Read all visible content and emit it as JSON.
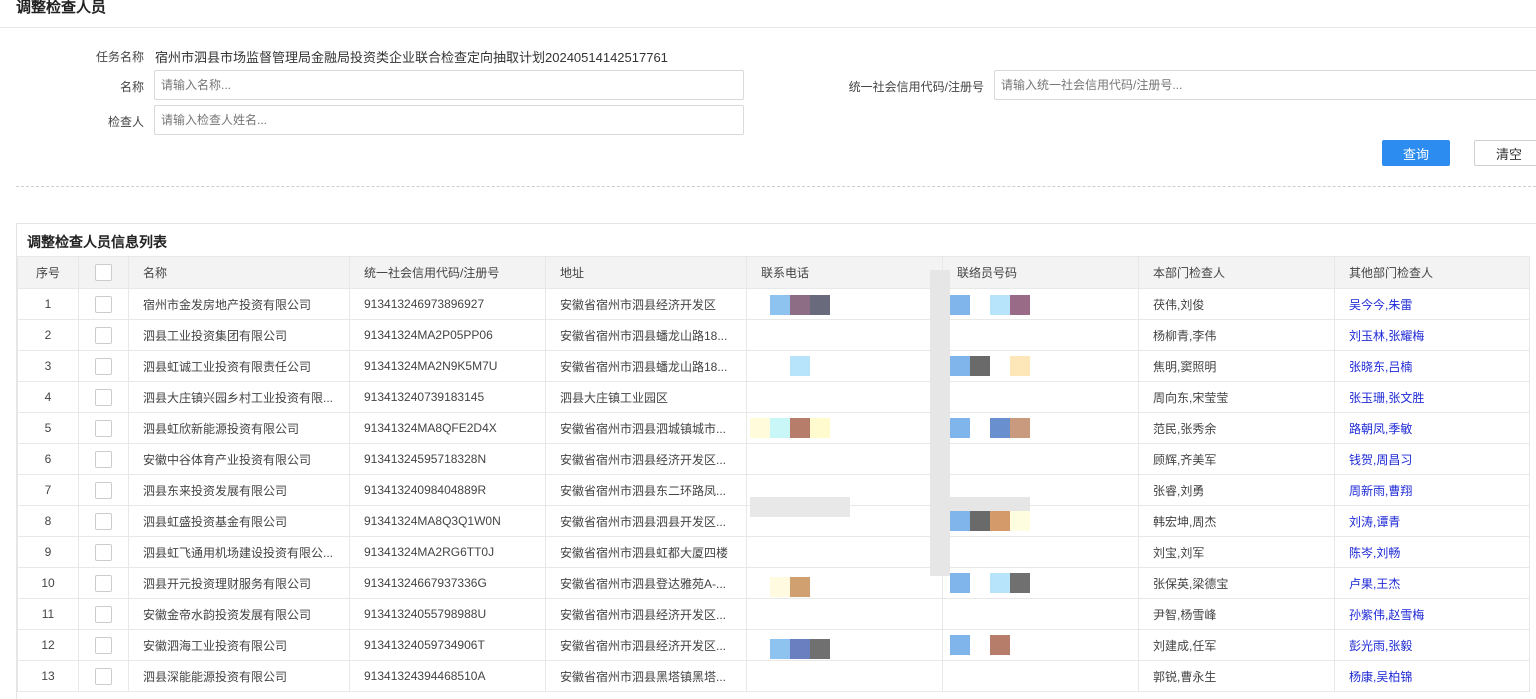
{
  "page": {
    "title": "调整检查人员"
  },
  "task": {
    "label": "任务名称",
    "value": "宿州市泗县市场监督管理局金融局投资类企业联合检查定向抽取计划20240514142517761"
  },
  "form": {
    "name_label": "名称",
    "name_placeholder": "请输入名称...",
    "credit_label": "统一社会信用代码/注册号",
    "credit_placeholder": "请输入统一社会信用代码/注册号...",
    "inspector_label": "检查人",
    "inspector_placeholder": "请输入检查人姓名..."
  },
  "buttons": {
    "query": "查询",
    "clear": "清空"
  },
  "list": {
    "title": "调整检查人员信息列表",
    "columns": [
      "序号",
      "",
      "名称",
      "统一社会信用代码/注册号",
      "地址",
      "联系电话",
      "联络员号码",
      "本部门检查人",
      "其他部门检查人"
    ],
    "rows": [
      {
        "idx": "1",
        "name": "宿州市金发房地产投资有限公司",
        "code": "913413246973896927",
        "addr": "安徽省宿州市泗县经济开发区",
        "phone": "",
        "liaison": "",
        "dept": "茯伟,刘俊",
        "other": "吴今今,朱雷"
      },
      {
        "idx": "2",
        "name": "泗县工业投资集团有限公司",
        "code": "91341324MA2P05PP06",
        "addr": "安徽省宿州市泗县蟠龙山路18...",
        "phone": "",
        "liaison": "",
        "dept": "杨柳青,李伟",
        "other": "刘玉林,张耀梅"
      },
      {
        "idx": "3",
        "name": "泗县虹诚工业投资有限责任公司",
        "code": "91341324MA2N9K5M7U",
        "addr": "安徽省宿州市泗县蟠龙山路18...",
        "phone": "",
        "liaison": "",
        "dept": "焦明,窦照明",
        "other": "张晓东,吕楠"
      },
      {
        "idx": "4",
        "name": "泗县大庄镇兴园乡村工业投资有限...",
        "code": "913413240739183145",
        "addr": "泗县大庄镇工业园区",
        "phone": "",
        "liaison": "",
        "dept": "周向东,宋莹莹",
        "other": "张玉珊,张文胜"
      },
      {
        "idx": "5",
        "name": "泗县虹欣新能源投资有限公司",
        "code": "91341324MA8QFE2D4X",
        "addr": "安徽省宿州市泗县泗城镇城市...",
        "phone": "",
        "liaison": "",
        "dept": "范民,张秀余",
        "other": "路朝凤,季敏"
      },
      {
        "idx": "6",
        "name": "安徽中谷体育产业投资有限公司",
        "code": "91341324595718328N",
        "addr": "安徽省宿州市泗县经济开发区...",
        "phone": "",
        "liaison": "",
        "dept": "顾辉,齐美军",
        "other": "钱贺,周昌习"
      },
      {
        "idx": "7",
        "name": "泗县东来投资发展有限公司",
        "code": "91341324098404889R",
        "addr": "安徽省宿州市泗县东二环路凤...",
        "phone": "",
        "liaison": "",
        "dept": "张睿,刘勇",
        "other": "周新雨,曹翔"
      },
      {
        "idx": "8",
        "name": "泗县虹盛投资基金有限公司",
        "code": "91341324MA8Q3Q1W0N",
        "addr": "安徽省宿州市泗县泗县开发区...",
        "phone": "",
        "liaison": "",
        "dept": "韩宏坤,周杰",
        "other": "刘涛,谭青"
      },
      {
        "idx": "9",
        "name": "泗县虹飞通用机场建设投资有限公...",
        "code": "91341324MA2RG6TT0J",
        "addr": "安徽省宿州市泗县虹都大厦四楼",
        "phone": "",
        "liaison": "",
        "dept": "刘宝,刘军",
        "other": "陈岑,刘畅"
      },
      {
        "idx": "10",
        "name": "泗县开元投资理财服务有限公司",
        "code": "91341324667937336G",
        "addr": "安徽省宿州市泗县登达雅苑A-...",
        "phone": "",
        "liaison": "",
        "dept": "张保英,梁德宝",
        "other": "卢果,王杰"
      },
      {
        "idx": "11",
        "name": "安徽金帝水韵投资发展有限公司",
        "code": "91341324055798988U",
        "addr": "安徽省宿州市泗县经济开发区...",
        "phone": "",
        "liaison": "",
        "dept": "尹智,杨雪峰",
        "other": "孙紫伟,赵雪梅"
      },
      {
        "idx": "12",
        "name": "安徽泗海工业投资有限公司",
        "code": "91341324059734906T",
        "addr": "安徽省宿州市泗县经济开发区...",
        "phone": "",
        "liaison": "",
        "dept": "刘建成,任军",
        "other": "彭光雨,张毅"
      },
      {
        "idx": "13",
        "name": "泗县深能能源投资有限公司",
        "code": "91341324394468510A",
        "addr": "安徽省宿州市泗县黑塔镇黑塔...",
        "phone": "",
        "liaison": "",
        "dept": "郭锐,曹永生",
        "other": "杨康,吴柏锦"
      }
    ]
  },
  "colors": {
    "primary": "#2d8cf0",
    "link": "#1f2ad6",
    "header_bg": "#f3f3f3"
  }
}
